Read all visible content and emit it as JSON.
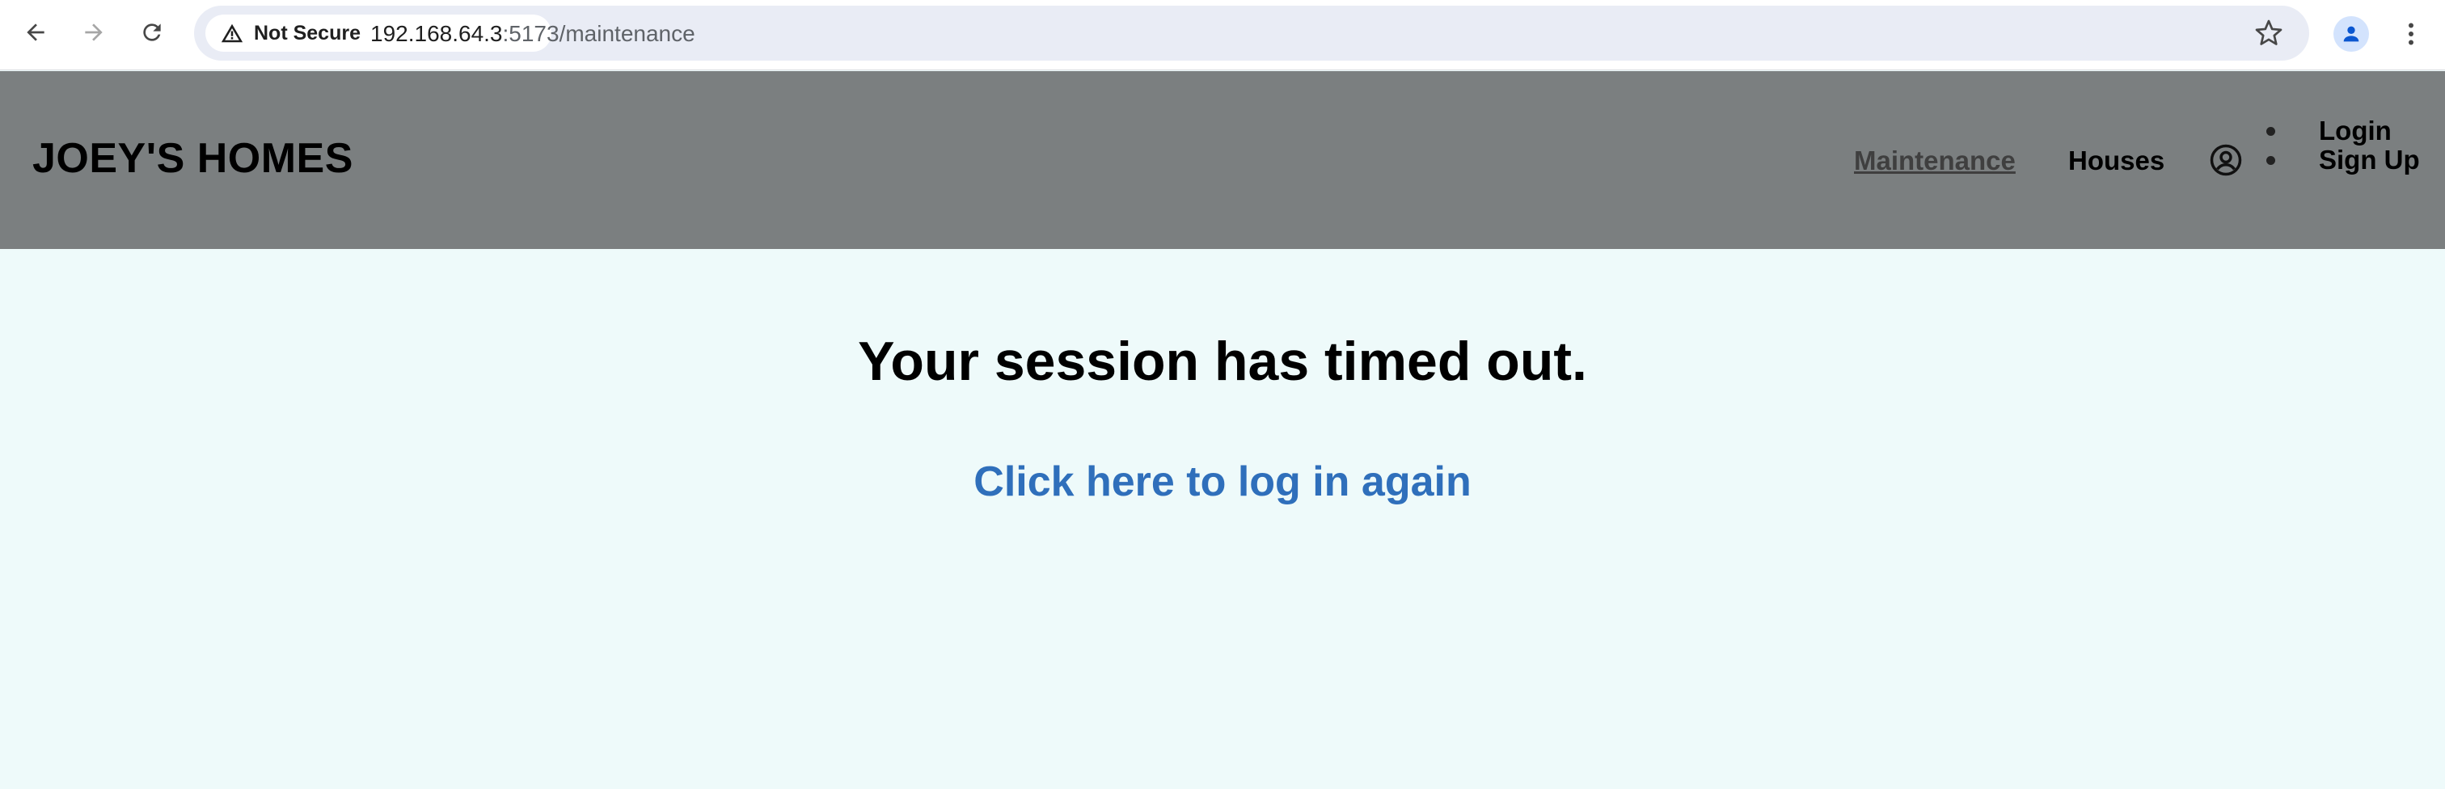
{
  "browser": {
    "security_label": "Not Secure",
    "url_host": "192.168.64.3",
    "url_path": ":5173/maintenance",
    "icons": [
      "back-icon",
      "forward-icon",
      "reload-icon",
      "warning-icon",
      "star-icon",
      "profile-icon",
      "more-vert-icon"
    ]
  },
  "header": {
    "brand": "JOEY'S HOMES",
    "nav": [
      {
        "label": "Maintenance",
        "active": true
      },
      {
        "label": "Houses",
        "active": false
      }
    ],
    "user_icon": "user-circle-icon",
    "auth": [
      {
        "label": "Login"
      },
      {
        "label": "Sign Up"
      }
    ],
    "background": "#7b7f80"
  },
  "main": {
    "message": "Your session has timed out.",
    "link_text": "Click here to log in again",
    "background": "#eefafa",
    "link_color": "#2f6fbb"
  }
}
